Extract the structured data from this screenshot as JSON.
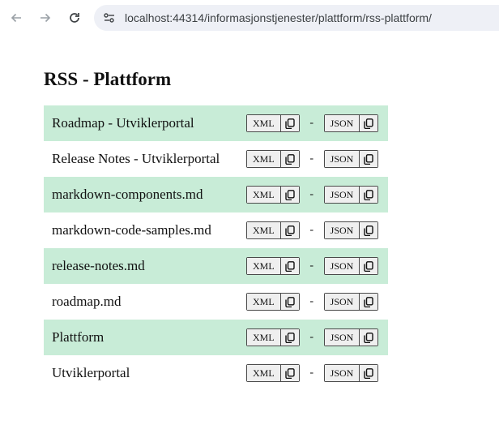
{
  "browser": {
    "url": "localhost:44314/informasjonstjenester/plattform/rss-plattform/",
    "back_icon": "arrow-left-icon",
    "forward_icon": "arrow-right-icon",
    "reload_icon": "reload-icon",
    "site_info_icon": "site-settings-icon"
  },
  "page": {
    "title": "RSS - Plattform"
  },
  "labels": {
    "xml": "XML",
    "json": "JSON",
    "separator": "-"
  },
  "feeds": [
    {
      "name": "Roadmap - Utviklerportal"
    },
    {
      "name": "Release Notes - Utviklerportal"
    },
    {
      "name": "markdown-components.md"
    },
    {
      "name": "markdown-code-samples.md"
    },
    {
      "name": "release-notes.md"
    },
    {
      "name": "roadmap.md"
    },
    {
      "name": "Plattform"
    },
    {
      "name": "Utviklerportal"
    }
  ],
  "colors": {
    "row_highlight": "#c8ecd7",
    "address_bar": "#eef0f6"
  }
}
